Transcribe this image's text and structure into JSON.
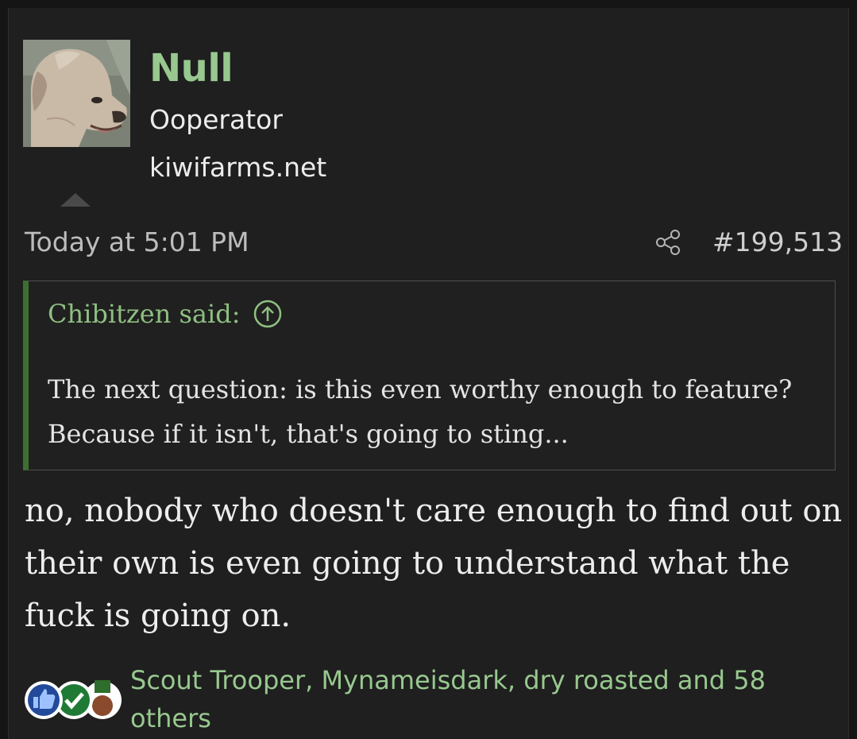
{
  "user": {
    "name": "Null",
    "title": "Ooperator",
    "site": "kiwifarms.net",
    "avatar_icon": "dog-avatar-icon"
  },
  "post": {
    "date": "Today at 5:01 PM",
    "number": "#199,513",
    "body": "no, nobody who doesn't care enough to find out on their own is even going to understand what the fuck is going on."
  },
  "quote": {
    "author_said": "Chibitzen said:",
    "body": "The next question: is this even worthy enough to feature? Because if it isn't, that's going to sting..."
  },
  "reactions": {
    "icons": [
      "thumbs-up-icon",
      "checkmark-icon",
      "winner-medal-icon"
    ],
    "summary": "Scout Trooper, Mynameisdark, dry roasted and 58 others"
  },
  "colors": {
    "background": "#1f1f1f",
    "accent_green": "#98c88f",
    "quote_border": "#3d6f30"
  }
}
